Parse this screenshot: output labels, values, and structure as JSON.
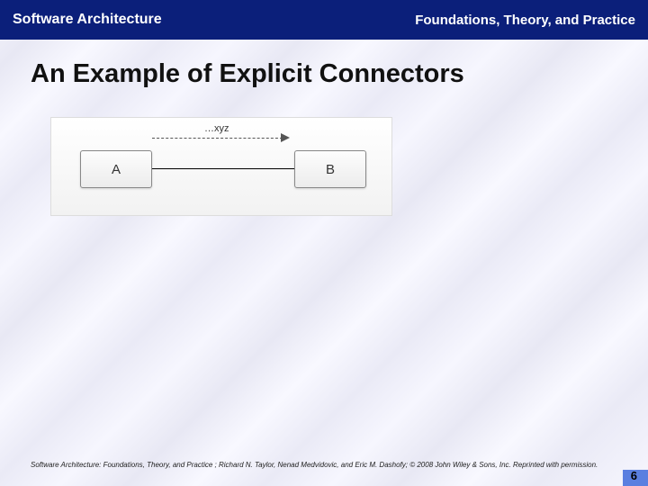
{
  "header": {
    "left": "Software Architecture",
    "right": "Foundations, Theory, and Practice"
  },
  "title": "An Example of Explicit Connectors",
  "diagram": {
    "box_a": "A",
    "box_b": "B",
    "arrow_label": "…xyz"
  },
  "footer": {
    "citation": "Software Architecture: Foundations, Theory, and Practice ; Richard N. Taylor, Nenad Medvidovic, and Eric M. Dashofy; © 2008 John Wiley & Sons, Inc. Reprinted with permission."
  },
  "page_number": "6"
}
